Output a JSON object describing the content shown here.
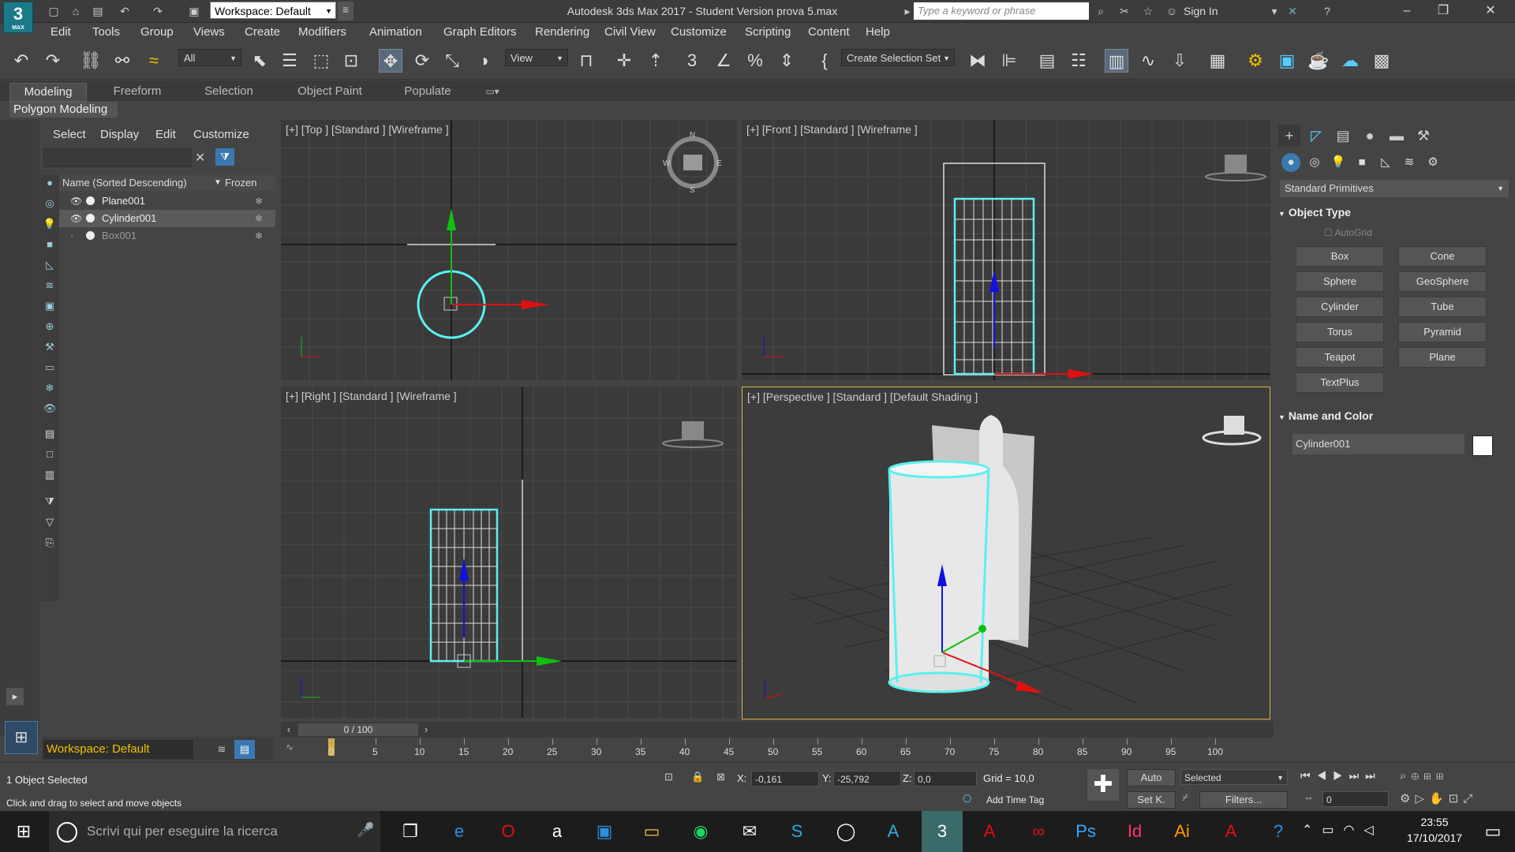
{
  "app": {
    "title": "Autodesk 3ds Max 2017 - Student Version     prova 5.max",
    "logo": "3",
    "logo_sub": "MAX",
    "workspace": "Workspace: Default",
    "search_placeholder": "Type a keyword or phrase",
    "sign_in": "Sign In"
  },
  "menubar": [
    "Edit",
    "Tools",
    "Group",
    "Views",
    "Create",
    "Modifiers",
    "Animation",
    "Graph Editors",
    "Rendering",
    "Civil View",
    "Customize",
    "Scripting",
    "Content",
    "Help"
  ],
  "toolbar": {
    "filter": "All",
    "view": "View",
    "selection_set": "Create Selection Set"
  },
  "ribbon": {
    "tabs": [
      "Modeling",
      "Freeform",
      "Selection",
      "Object Paint",
      "Populate"
    ],
    "active_tab": "Modeling",
    "panel": "Polygon Modeling"
  },
  "explorer": {
    "menu": [
      "Select",
      "Display",
      "Edit",
      "Customize"
    ],
    "column_name": "Name (Sorted Descending)",
    "column_frozen": "Frozen",
    "rows": [
      {
        "name": "Plane001",
        "selected": false
      },
      {
        "name": "Cylinder001",
        "selected": true
      },
      {
        "name": "Box001",
        "selected": false
      }
    ],
    "workspace": "Workspace: Default"
  },
  "viewports": {
    "top": "[+] [Top ] [Standard ] [Wireframe ]",
    "front": "[+] [Front ] [Standard ] [Wireframe ]",
    "right": "[+] [Right ] [Standard ] [Wireframe ]",
    "perspective": "[+] [Perspective ] [Standard ] [Default Shading ]",
    "compass": {
      "n": "N",
      "s": "S",
      "w": "W",
      "e": "E"
    }
  },
  "command_panel": {
    "category": "Standard Primitives",
    "object_type_title": "Object Type",
    "autogrid": "AutoGrid",
    "buttons": [
      "Box",
      "Cone",
      "Sphere",
      "GeoSphere",
      "Cylinder",
      "Tube",
      "Torus",
      "Pyramid",
      "Teapot",
      "Plane",
      "TextPlus"
    ],
    "name_color_title": "Name and Color",
    "object_name": "Cylinder001",
    "object_color": "#ffffff"
  },
  "timeline": {
    "frame": "0 / 100",
    "ticks": [
      "0",
      "5",
      "10",
      "15",
      "20",
      "25",
      "30",
      "35",
      "40",
      "45",
      "50",
      "55",
      "60",
      "65",
      "70",
      "75",
      "80",
      "85",
      "90",
      "95",
      "100"
    ]
  },
  "status": {
    "selected": "1 Object Selected",
    "prompt": "Click and drag to select and move objects",
    "x_label": "X:",
    "x": "-0,161",
    "y_label": "Y:",
    "y": "-25,792",
    "z_label": "Z:",
    "z": "0,0",
    "grid": "Grid = 10,0",
    "add_time_tag": "Add Time Tag",
    "auto": "Auto",
    "set_key": "Set K.",
    "selected_dropdown": "Selected",
    "filters": "Filters...",
    "frame_field": "0"
  },
  "taskbar": {
    "search_placeholder": "Scrivi qui per eseguire la ricerca",
    "time": "23:55",
    "date": "17/10/2017"
  },
  "colors": {
    "selection": "#5af0f0",
    "axis_x": "#e01010",
    "axis_y": "#10c010",
    "axis_z": "#1010e0",
    "active_viewport_border": "#d8b040",
    "workspace_text": "#f0c000"
  }
}
